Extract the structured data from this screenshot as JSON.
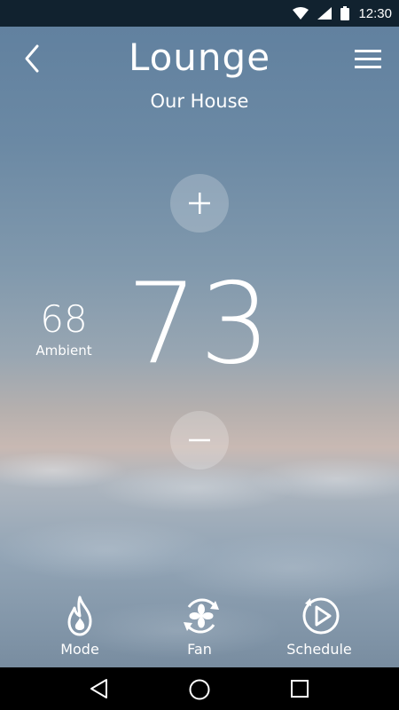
{
  "status_bar": {
    "time": "12:30",
    "icons": [
      "wifi-icon",
      "signal-icon",
      "battery-icon"
    ]
  },
  "header": {
    "title": "Lounge",
    "subtitle": "Our House",
    "back_icon": "chevron-left-icon",
    "menu_icon": "hamburger-menu-icon"
  },
  "thermostat": {
    "setpoint": "73",
    "ambient_value": "68",
    "ambient_label": "Ambient"
  },
  "bottom_bar": [
    {
      "label": "Mode",
      "icon": "flame-icon"
    },
    {
      "label": "Fan",
      "icon": "fan-icon"
    },
    {
      "label": "Schedule",
      "icon": "schedule-play-icon"
    }
  ],
  "nav_bar": [
    "back-triangle-icon",
    "home-circle-icon",
    "recents-square-icon"
  ]
}
